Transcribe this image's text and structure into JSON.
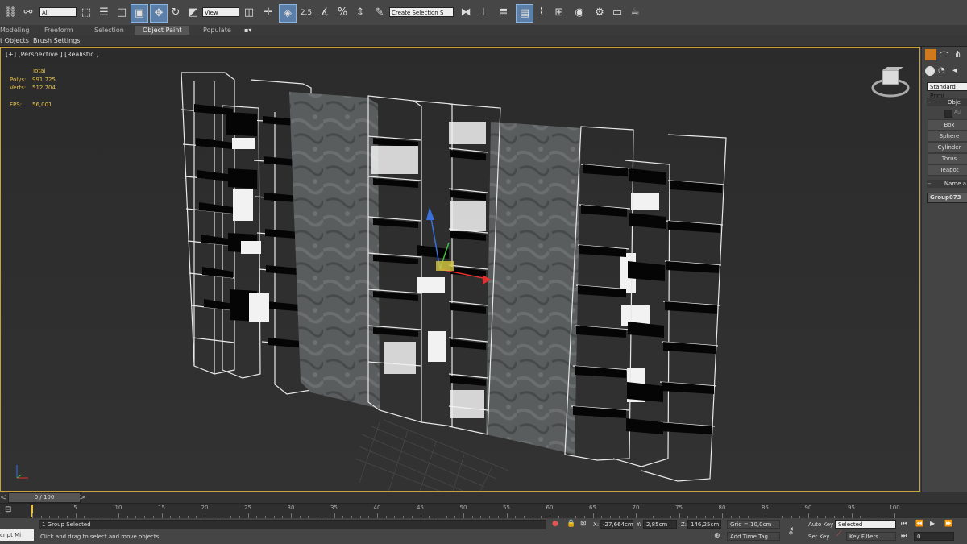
{
  "toolbar": {
    "filter_select": "All",
    "ref_coord_select": "View",
    "snap_value": "2,5",
    "selection_set_placeholder": "Create Selection S"
  },
  "ribbon": {
    "tabs": [
      "Modeling",
      "Freeform",
      "Selection",
      "Object Paint",
      "Populate"
    ],
    "active_tab": "Object Paint",
    "sub_items": [
      "t Objects",
      "Brush Settings"
    ]
  },
  "viewport": {
    "label": "[+] [Perspective ] [Realistic ]",
    "stats": {
      "header": "Total",
      "polys_label": "Polys:",
      "polys_value": "991 725",
      "verts_label": "Verts:",
      "verts_value": "512 704",
      "fps_label": "FPS:",
      "fps_value": "56,001"
    }
  },
  "command_panel": {
    "category_select": "Standard Primi",
    "rollout_title": "Obje",
    "autogrid_label": "Au",
    "buttons": [
      "Box",
      "Sphere",
      "Cylinder",
      "Torus",
      "Teapot"
    ],
    "name_rollout": "Name a",
    "object_name": "Group073"
  },
  "timeline": {
    "frame_display": "0 / 100",
    "ticks": [
      "5",
      "10",
      "15",
      "20",
      "25",
      "30",
      "35",
      "40",
      "45",
      "50",
      "55",
      "60",
      "65",
      "70",
      "75",
      "80",
      "85",
      "90",
      "95",
      "100"
    ]
  },
  "status": {
    "script_label": "cript Mi",
    "selection_info": "1 Group Selected",
    "prompt": "Click and drag to select and move objects",
    "x_label": "X:",
    "x_value": "-27,664cm",
    "y_label": "Y:",
    "y_value": "2,85cm",
    "z_label": "Z:",
    "z_value": "146,25cm",
    "grid": "Grid = 10,0cm",
    "add_time_tag": "Add Time Tag",
    "auto_key": "Auto Key",
    "auto_key_select": "Selected",
    "set_key": "Set Key",
    "key_filters": "Key Filters...",
    "frame_value": "0"
  },
  "colors": {
    "viewport_border": "#c9a336",
    "stats_text": "#e6c24a",
    "active_button": "#5b7fa8"
  }
}
